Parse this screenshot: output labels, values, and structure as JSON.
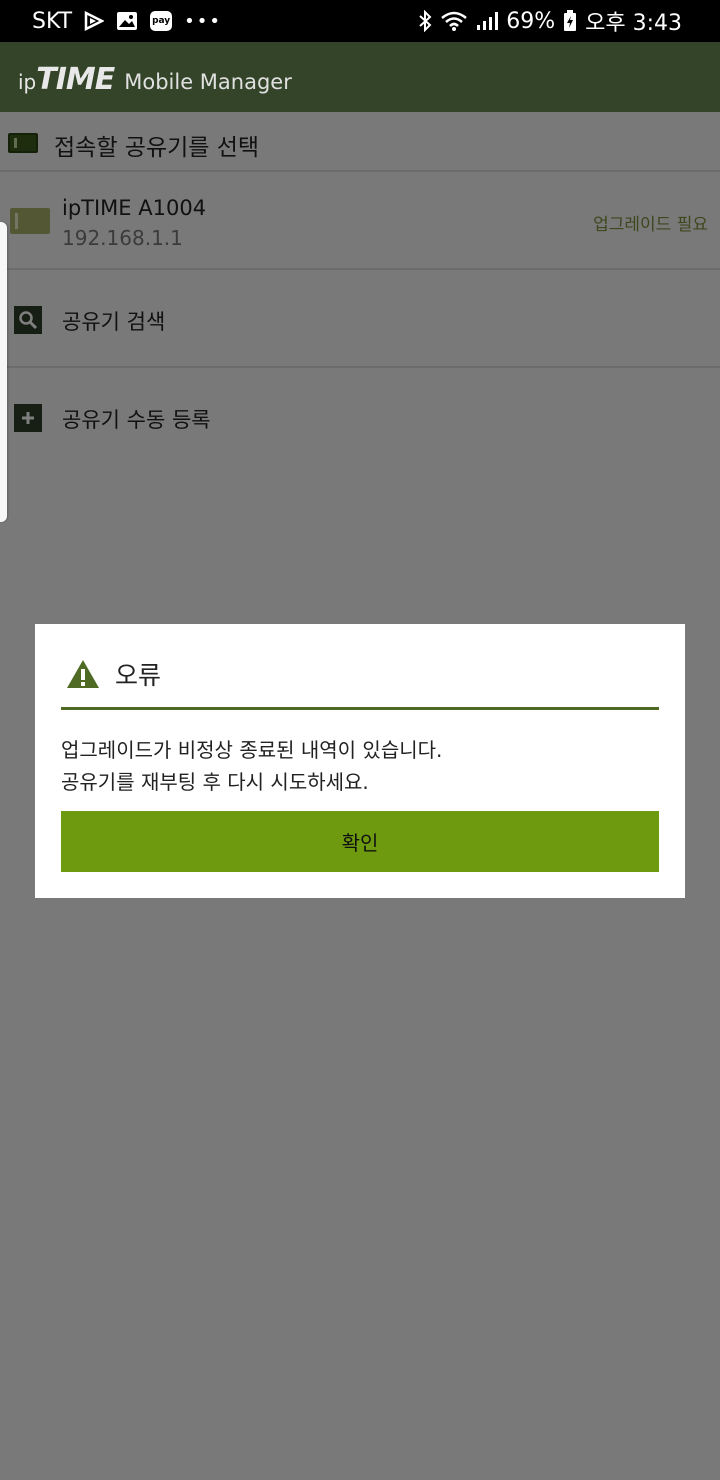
{
  "status_bar": {
    "carrier": "SKT",
    "pay_label": "pay",
    "more": "•••",
    "battery_percent": "69%",
    "time": "오후 3:43"
  },
  "app_bar": {
    "brand_ip": "ip",
    "brand_time": "TIME",
    "brand_subtitle": "Mobile Manager"
  },
  "list": {
    "header": "접속할 공유기를 선택",
    "router": {
      "name": "ipTIME A1004",
      "ip": "192.168.1.1",
      "status": "업그레이드 필요"
    },
    "actions": [
      {
        "label": "공유기 검색",
        "icon": "search-icon"
      },
      {
        "label": "공유기 수동 등록",
        "icon": "plus-icon"
      }
    ]
  },
  "dialog": {
    "title": "오류",
    "message_line1": "업그레이드가 비정상 종료된 내역이 있습니다.",
    "message_line2": "공유기를 재부팅 후 다시 시도하세요.",
    "confirm": "확인"
  },
  "colors": {
    "app_bar": "#334428",
    "accent": "#6e9a10",
    "divider": "#4e6a25",
    "status_text": "#7c8f3c"
  }
}
